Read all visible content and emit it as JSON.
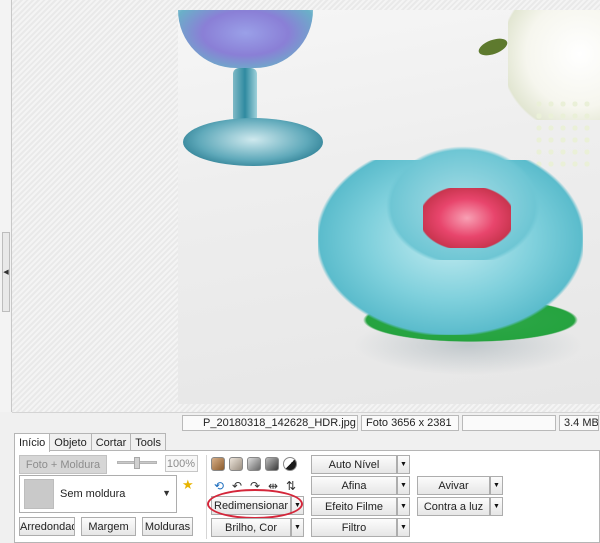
{
  "statusbar": {
    "filename": "P_20180318_142628_HDR.jpg",
    "dimensions": "Foto 3656 x 2381",
    "extra": "",
    "filesize": "3.4 MB"
  },
  "tabs": [
    "Início",
    "Objeto",
    "Cortar",
    "Tools"
  ],
  "frame": {
    "photo_plus_frame_label": "Foto + Moldura",
    "opacity_value": "100%",
    "selected_frame": "Sem moldura",
    "rounded_label": "Arredondado",
    "margin_label": "Margem",
    "frames_label": "Molduras"
  },
  "adjust": {
    "resize_label": "Redimensionar",
    "brightness_label": "Brilho, Cor",
    "auto_level_label": "Auto Nível",
    "sharpen_label": "Afina",
    "film_effect_label": "Efeito Filme",
    "filter_label": "Filtro",
    "enhance_label": "Avivar",
    "backlight_label": "Contra a luz"
  },
  "icons": {
    "swatches": [
      "#8a5a2b",
      "#9a8e80",
      "#666666",
      "#3a3a3a"
    ],
    "tools": [
      "rotate-icon",
      "undo-icon",
      "redo-icon",
      "flip-horizontal-icon",
      "flip-vertical-icon"
    ]
  },
  "colors": {
    "highlight": "#d4263a",
    "star": "#e8b400"
  }
}
